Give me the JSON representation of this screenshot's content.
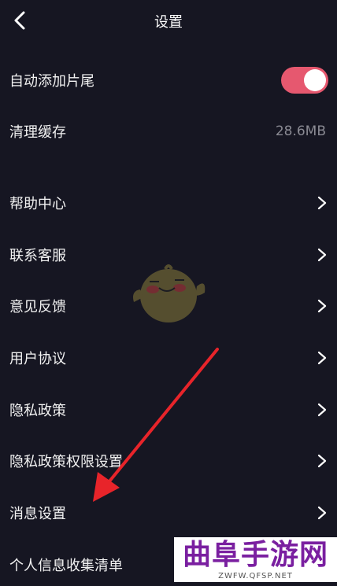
{
  "header": {
    "title": "设置"
  },
  "settings": {
    "auto_ending": {
      "label": "自动添加片尾",
      "enabled": true
    },
    "clear_cache": {
      "label": "清理缓存",
      "value": "28.6MB"
    },
    "menu": [
      {
        "label": "帮助中心"
      },
      {
        "label": "联系客服"
      },
      {
        "label": "意见反馈"
      },
      {
        "label": "用户协议"
      },
      {
        "label": "隐私政策"
      },
      {
        "label": "隐私政策权限设置"
      },
      {
        "label": "消息设置"
      },
      {
        "label": "个人信息收集清单"
      }
    ]
  },
  "watermark": {
    "main": "曲阜手游网",
    "sub": "ZWFW.QFSP.NET"
  },
  "colors": {
    "background": "#161622",
    "toggle_on": "#e6586f",
    "annotation_arrow": "#e8242a",
    "watermark_text": "#7a1fa0"
  }
}
